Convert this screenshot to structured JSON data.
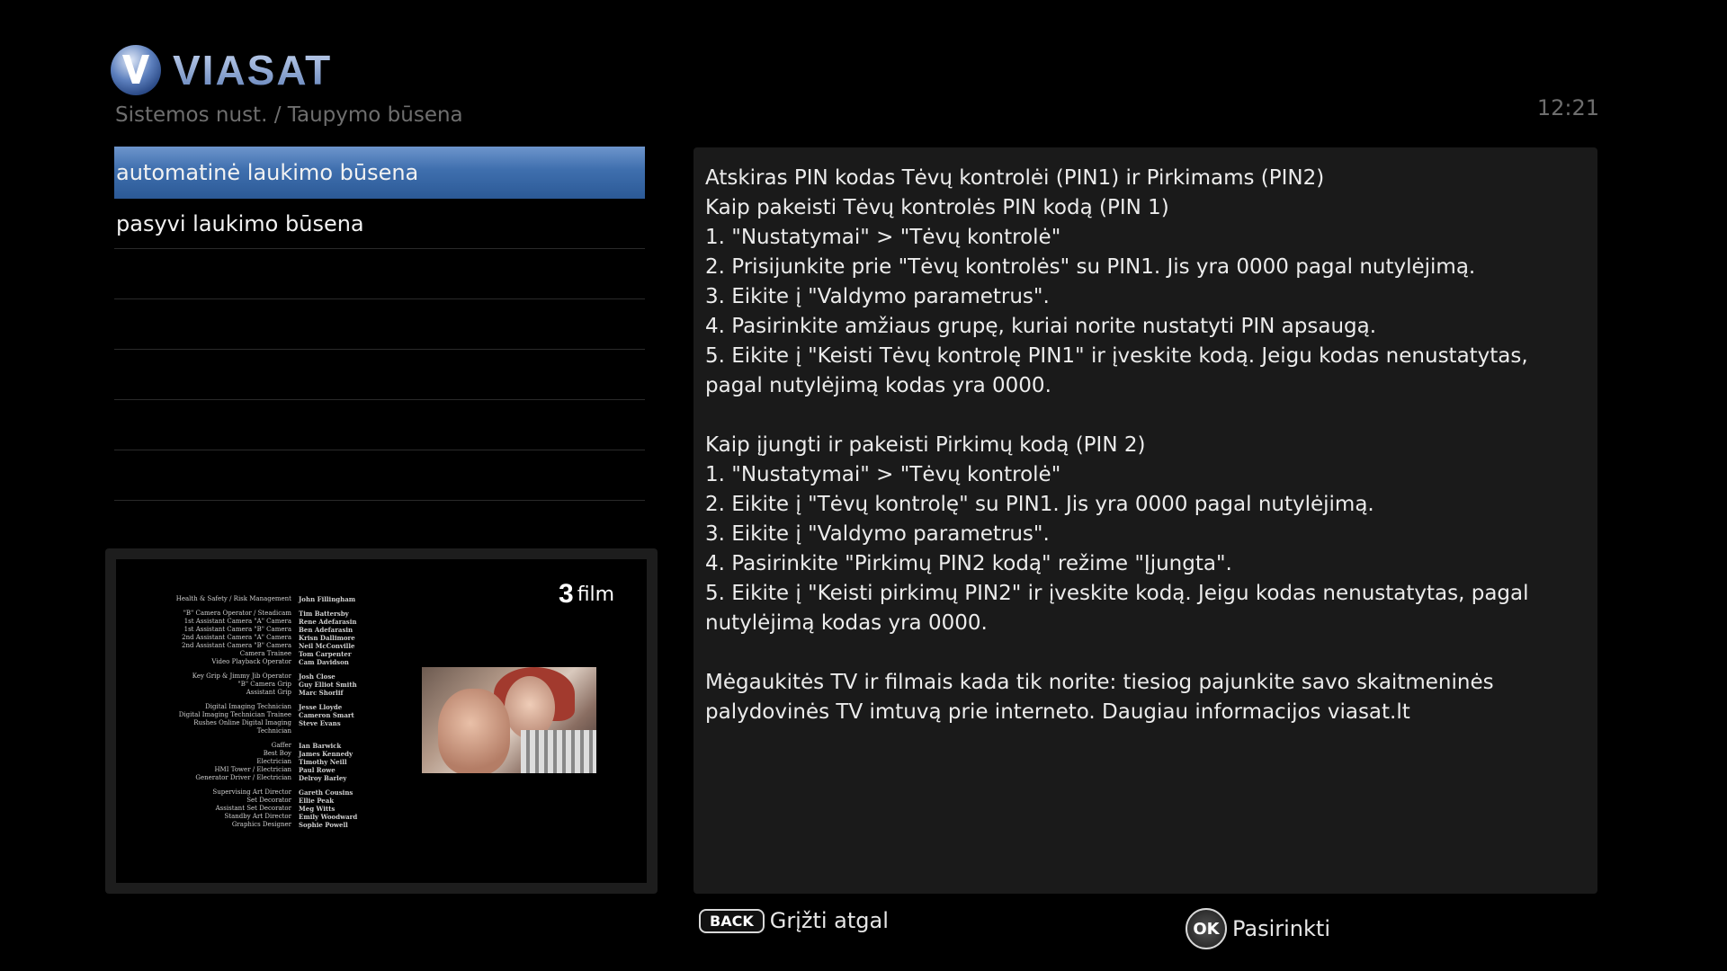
{
  "brand": {
    "name": "VIASAT",
    "accent": "#3f6fae"
  },
  "header": {
    "breadcrumb": "Sistemos nust. / Taupymo būsena",
    "clock": "12:21"
  },
  "menu": {
    "items": [
      {
        "label": "automatinė laukimo būsena",
        "selected": true
      },
      {
        "label": "pasyvi laukimo būsena",
        "selected": false
      },
      {
        "label": ""
      },
      {
        "label": ""
      },
      {
        "label": ""
      },
      {
        "label": ""
      },
      {
        "label": ""
      }
    ]
  },
  "preview": {
    "channel_number": "3",
    "channel_name": "film",
    "credits": [
      [
        "Health & Safety / Risk Management",
        "John Fillingham"
      ],
      [
        ""
      ],
      [
        "\"B\" Camera Operator / Steadicam",
        "Tim Battersby"
      ],
      [
        "1st Assistant Camera \"A\" Camera",
        "Rene Adefarasin"
      ],
      [
        "1st Assistant Camera \"B\" Camera",
        "Ben Adefarasin"
      ],
      [
        "2nd Assistant Camera \"A\" Camera",
        "Krisn Dallimore"
      ],
      [
        "2nd Assistant Camera \"B\" Camera",
        "Neil McConville"
      ],
      [
        "Camera Trainee",
        "Tom Carpenter"
      ],
      [
        "Video Playback Operator",
        "Cam Davidson"
      ],
      [
        ""
      ],
      [
        "Key Grip & Jimmy Jib Operator",
        "Josh Close"
      ],
      [
        "\"B\" Camera Grip",
        "Guy Elliot Smith"
      ],
      [
        "Assistant Grip",
        "Marc Shorlif"
      ],
      [
        ""
      ],
      [
        "Digital Imaging Technician",
        "Jesse Lloyde"
      ],
      [
        "Digital Imaging Technician Trainee",
        "Cameron Smart"
      ],
      [
        "Rushes Online Digital Imaging Technician",
        "Steve Evans"
      ],
      [
        ""
      ],
      [
        "Gaffer",
        "Ian Barwick"
      ],
      [
        "Best Boy",
        "James Kennedy"
      ],
      [
        "Electrician",
        "Timothy Neill"
      ],
      [
        "HMI Tower / Electrician",
        "Paul Rowe"
      ],
      [
        "Generator Driver / Electrician",
        "Delroy Barley"
      ],
      [
        ""
      ],
      [
        "Supervising Art Director",
        "Gareth Cousins"
      ],
      [
        "Set Decorator",
        "Ellie Peak"
      ],
      [
        "Assistant Set Decorator",
        "Meg Witts"
      ],
      [
        "Standby Art Director",
        "Emily Woodward"
      ],
      [
        "Graphics Designer",
        "Sophie Powell"
      ]
    ]
  },
  "info": {
    "lines": [
      "Atskiras PIN kodas Tėvų kontrolėi (PIN1) ir Pirkimams (PIN2)",
      "Kaip pakeisti Tėvų kontrolės PIN kodą (PIN 1)",
      "1. \"Nustatymai\" > \"Tėvų kontrolė\"",
      "2. Prisijunkite prie \"Tėvų kontrolės\" su PIN1. Jis yra 0000 pagal nutylėjimą.",
      "3. Eikite į \"Valdymo parametrus\".",
      "4. Pasirinkite amžiaus grupę, kuriai norite nustatyti PIN apsaugą.",
      "5. Eikite į \"Keisti Tėvų kontrolę PIN1\" ir įveskite kodą.  Jeigu kodas nenustatytas, pagal nutylėjimą kodas yra 0000.",
      "",
      "Kaip įjungti ir pakeisti Pirkimų kodą (PIN 2)",
      "1. \"Nustatymai\" > \"Tėvų kontrolė\"",
      "2. Eikite į \"Tėvų kontrolę\" su PIN1. Jis yra 0000 pagal nutylėjimą.",
      "3. Eikite į \"Valdymo parametrus\".",
      "4. Pasirinkite \"Pirkimų PIN2 kodą\" režime \"Įjungta\".",
      "5. Eikite į \"Keisti pirkimų PIN2\" ir įveskite kodą. Jeigu kodas nenustatytas, pagal nutylėjimą kodas yra 0000.",
      "",
      "Mėgaukitės TV ir filmais kada tik norite: tiesiog pajunkite savo skaitmeninės palydovinės TV imtuvą prie interneto. Daugiau informacijos  viasat.lt"
    ]
  },
  "footer": {
    "back_key": "BACK",
    "back_label": "Grįžti atgal",
    "ok_key": "OK",
    "ok_label": "Pasirinkti"
  }
}
